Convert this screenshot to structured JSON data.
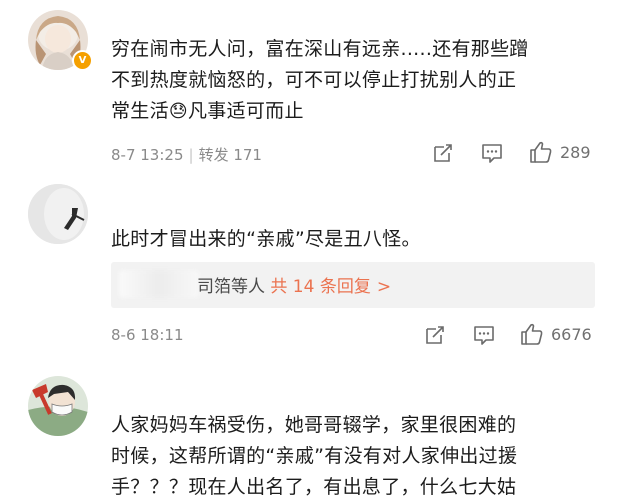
{
  "comments": [
    {
      "text_line1": "穷在闹市无人问，富在深山有远亲.....还有那些蹭",
      "text_line2": "不到热度就恼怒的，可不可以停止打扰别人的正",
      "text_line3_a": "常生活",
      "emoji": "😓",
      "text_line3_b": "凡事适可而止",
      "date": "8-7 13:25",
      "repost_label": "转发 171",
      "likes": "289"
    },
    {
      "text": "此时才冒出来的“亲戚”尽是丑八怪。",
      "reply_users": "司箔等人",
      "reply_count": "共 14 条回复",
      "reply_arrow": ">",
      "date": "8-6 18:11",
      "likes": "6676"
    },
    {
      "text_line1": "人家妈妈车祸受伤，她哥哥辍学，家里很困难的",
      "text_line2": "时候，这帮所谓的“亲戚”有没有对人家伸出过援",
      "text_line3": "手？？？现在人出名了，有出息了，什么七大姑"
    }
  ],
  "colors": {
    "verified_badge": "#f5a000",
    "link": "#eb7350",
    "meta": "#8a8a8a",
    "icon": "#6b6b6b"
  },
  "icons": [
    "verified-badge-icon",
    "repost-icon",
    "comment-icon",
    "like-icon"
  ]
}
